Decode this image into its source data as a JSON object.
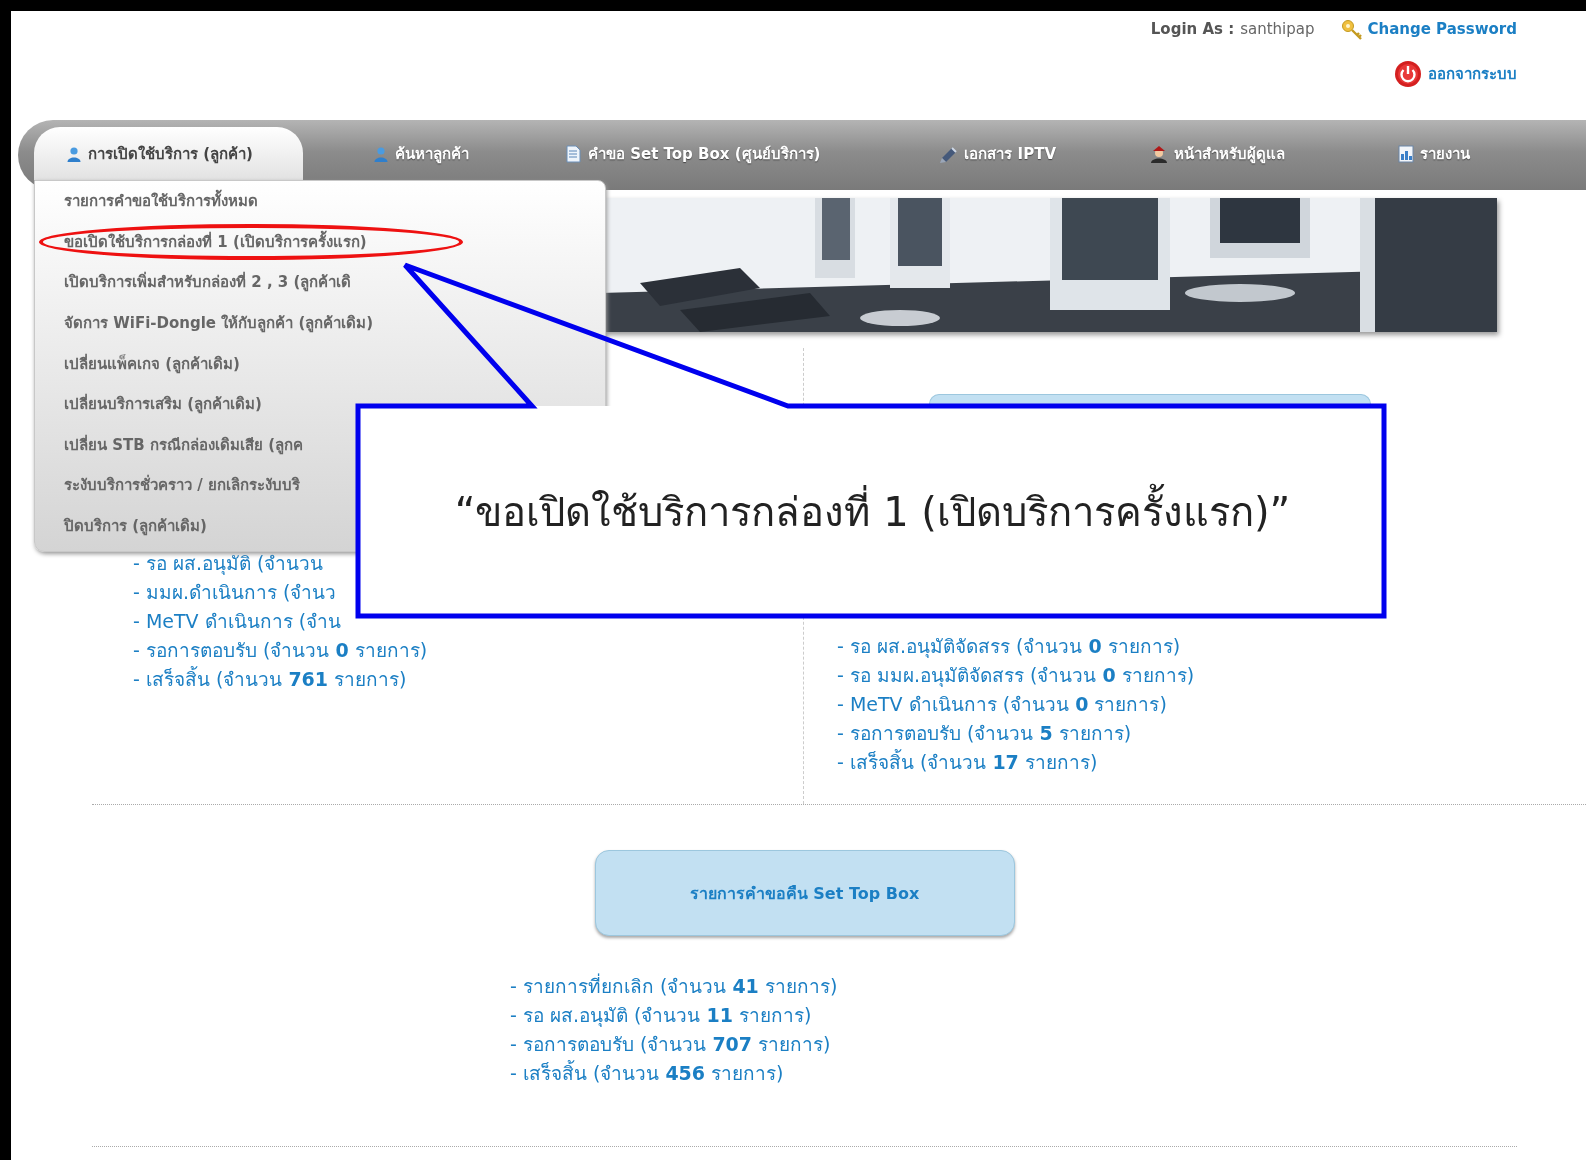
{
  "header": {
    "login_label": "Login As :",
    "username": "santhipap",
    "change_password": "Change Password",
    "logout": "ออกจากระบบ"
  },
  "nav": [
    {
      "label": "การเปิดใช้บริการ (ลูกค้า)",
      "kind": "user",
      "selected": true
    },
    {
      "label": "ค้นหาลูกค้า",
      "kind": "user",
      "selected": false
    },
    {
      "label": "คำขอ Set Top Box (ศูนย์บริการ)",
      "kind": "document",
      "selected": false
    },
    {
      "label": "เอกสาร IPTV",
      "kind": "pen",
      "selected": false
    },
    {
      "label": "หน้าสำหรับผู้ดูแล",
      "kind": "admin",
      "selected": false
    },
    {
      "label": "รายงาน",
      "kind": "report",
      "selected": false
    }
  ],
  "dropdown": {
    "items": [
      {
        "label": "รายการคำขอใช้บริการทั้งหมด",
        "circled": false
      },
      {
        "label": "ขอเปิดใช้บริการกล่องที่ 1 (เปิดบริการครั้งแรก)",
        "circled": true
      },
      {
        "label": "เปิดบริการเพิ่มสำหรับกล่องที่ 2 , 3 (ลูกค้าเดิ",
        "circled": false
      },
      {
        "label": "จัดการ WiFi-Dongle ให้กับลูกค้า (ลูกค้าเดิม)",
        "circled": false
      },
      {
        "label": "เปลี่ยนแพ็คเกจ (ลูกค้าเดิม)",
        "circled": false
      },
      {
        "label": "เปลี่ยนบริการเสริม (ลูกค้าเดิม)",
        "circled": false
      },
      {
        "label": "เปลี่ยน STB กรณีกล่องเดิมเสีย (ลูกค",
        "circled": false
      },
      {
        "label": "ระงับบริการชั่วคราว / ยกเลิกระงับบริ",
        "circled": false
      },
      {
        "label": "ปิดบริการ (ลูกค้าเดิม)",
        "circled": false
      }
    ]
  },
  "left_list": {
    "items": [
      "- รอ ผส.อนุมัติ (จำนวน",
      "- มมผ.ดำเนินการ (จำนว",
      "- MeTV ดำเนินการ (จำน",
      "- รอการตอบรับ (จำนวน **0** รายการ)",
      "- เสร็จสิ้น (จำนวน **761** รายการ)"
    ]
  },
  "right_list": {
    "items": [
      "- รอ ผส.อนุมัติจัดสรร (จำนวน **0** รายการ)",
      "- รอ มมผ.อนุมัติจัดสรร (จำนวน **0** รายการ)",
      "- MeTV ดำเนินการ (จำนวน **0** รายการ)",
      "- รอการตอบรับ (จำนวน **5** รายการ)",
      "- เสร็จสิ้น (จำนวน **17** รายการ)"
    ]
  },
  "return_section": {
    "button": "รายการคำขอคืน Set Top Box",
    "items": [
      "- รายการที่ยกเลิก (จำนวน **41** รายการ)",
      "- รอ ผส.อนุมัติ (จำนวน **11** รายการ)",
      "- รอการตอบรับ (จำนวน **707** รายการ)",
      "- เสร็จสิ้น (จำนวน **456** รายการ)"
    ]
  },
  "callout": {
    "text": "“ขอเปิดใช้บริการกล่องที่ 1 (เปิดบริการครั้งแรก)”"
  }
}
